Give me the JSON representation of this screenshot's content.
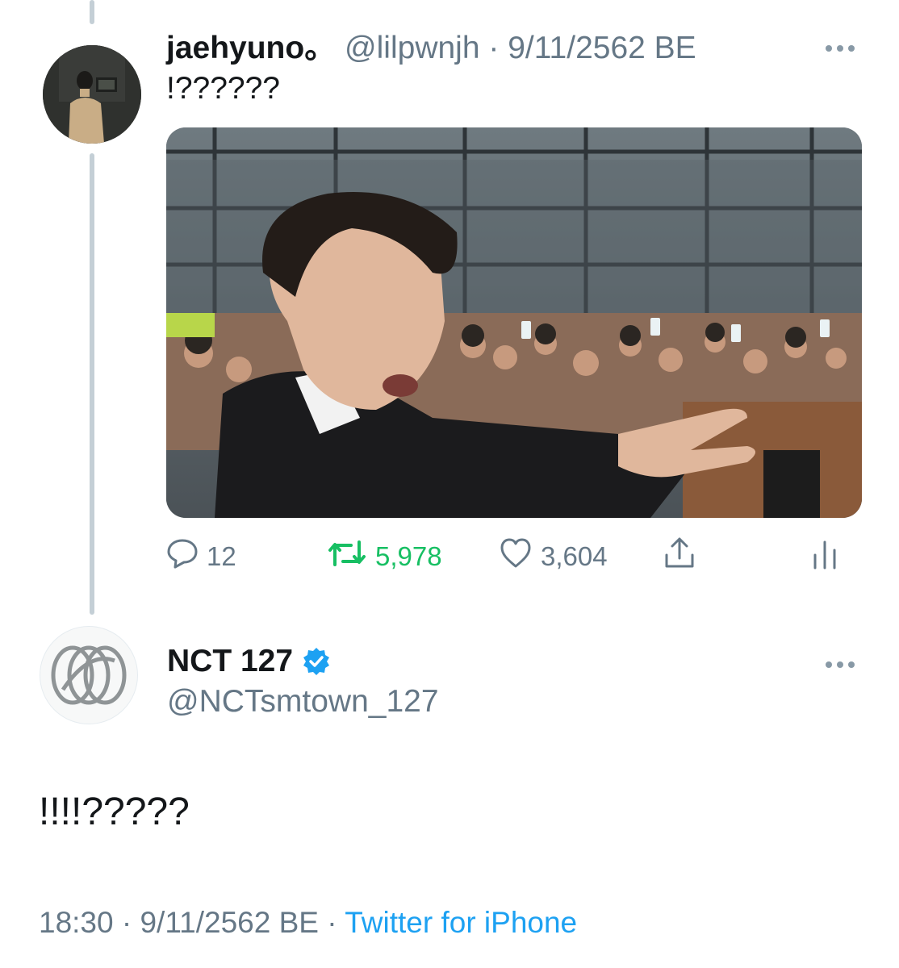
{
  "reply_tweet": {
    "display_name": "jaehyuno。",
    "handle": "@lilpwnjh",
    "separator": "·",
    "date": "9/11/2562 BE",
    "text": "!??????",
    "stats": {
      "replies": "12",
      "retweets": "5,978",
      "likes": "3,604"
    }
  },
  "main_tweet": {
    "display_name": "NCT 127",
    "handle": "@NCTsmtown_127",
    "verified": true,
    "text": "!!!!?????",
    "time": "18:30",
    "date": "9/11/2562 BE",
    "separator": "·",
    "source": "Twitter for iPhone"
  },
  "icons": {
    "more": "more-horizontal-icon",
    "reply": "reply-icon",
    "retweet": "retweet-icon",
    "like": "heart-icon",
    "share": "share-icon",
    "stats": "analytics-icon",
    "verified": "verified-badge-icon"
  },
  "colors": {
    "retweet_active": "#17bf63",
    "link": "#1da1f2",
    "secondary_text": "#657786",
    "verified": "#1da1f2"
  }
}
